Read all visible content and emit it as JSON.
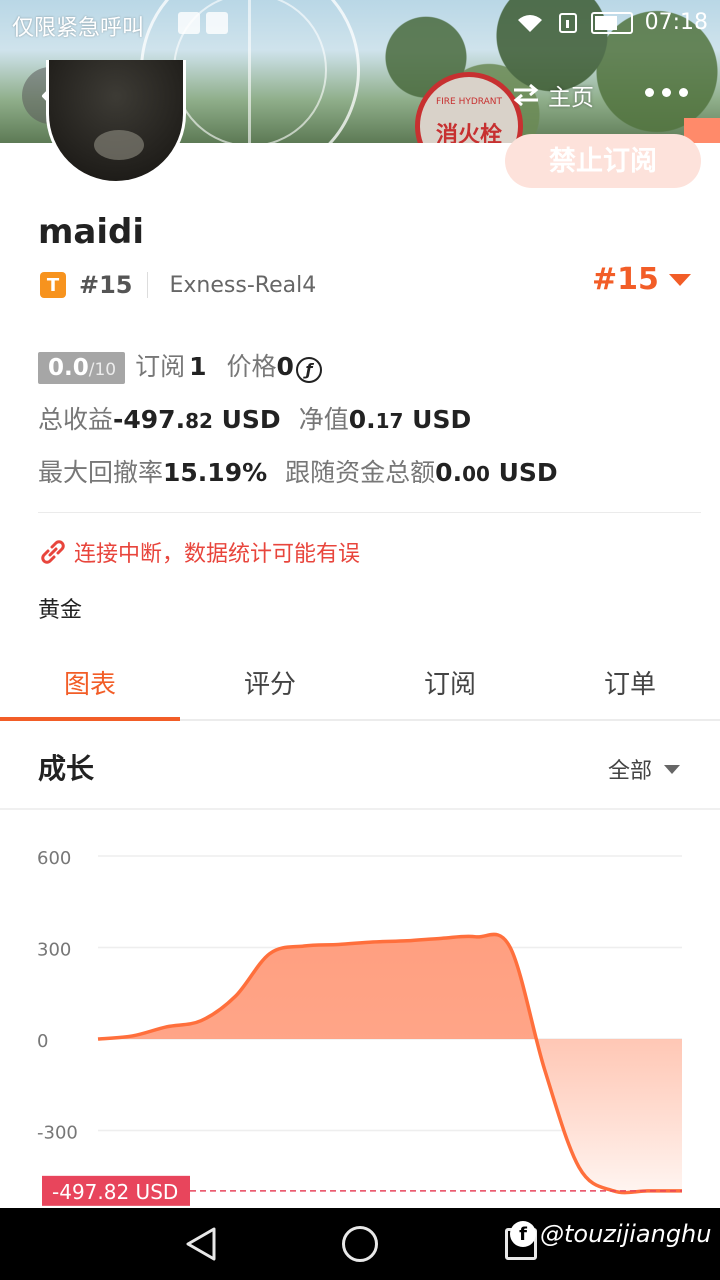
{
  "status_bar": {
    "carrier": "仅限紧急呼叫",
    "time": "07:18"
  },
  "nav": {
    "home_label": "主页"
  },
  "profile": {
    "subscribe_button": "禁止订阅",
    "username": "maidi",
    "badge_letter": "T",
    "rank": "#15",
    "server": "Exness-Real4",
    "rank_big": "#15"
  },
  "stats": {
    "score": "0.0",
    "score_max": "/10",
    "subscribe_label": "订阅",
    "subscribe_count": "1",
    "price_label": "价格",
    "price_value": "0",
    "coin_symbol": "ƒ",
    "total_profit_label": "总收益",
    "total_profit_int": "-497.",
    "total_profit_dec": "82",
    "total_profit_unit": " USD",
    "net_label": "净值",
    "net_int": "0.",
    "net_dec": "17",
    "net_unit": " USD",
    "drawdown_label": "最大回撤率",
    "drawdown_value": "15.19%",
    "follow_label": "跟随资金总额",
    "follow_int": "0.",
    "follow_dec": "00",
    "follow_unit": " USD"
  },
  "warning_text": "连接中断，数据统计可能有误",
  "tag": "黄金",
  "tabs": [
    "图表",
    "评分",
    "订阅",
    "订单"
  ],
  "chart_section": {
    "title": "成长",
    "filter": "全部"
  },
  "colors": {
    "accent": "#f25d27",
    "warning": "#e8453c",
    "line": "#ff6f3c",
    "fill_top": "#ff9f80"
  },
  "watermark": "@touzijianghu",
  "chart_data": {
    "type": "area",
    "y_ticks": [
      "600",
      "300",
      "0",
      "-300"
    ],
    "ylim": [
      -540,
      640
    ],
    "series": [
      {
        "values": [
          0,
          10,
          40,
          60,
          140,
          280,
          305,
          310,
          318,
          322,
          330,
          335,
          300,
          -100,
          -420,
          -497.82,
          -497.82,
          -497.82
        ]
      }
    ],
    "last_value_label": "-497.82 USD"
  }
}
